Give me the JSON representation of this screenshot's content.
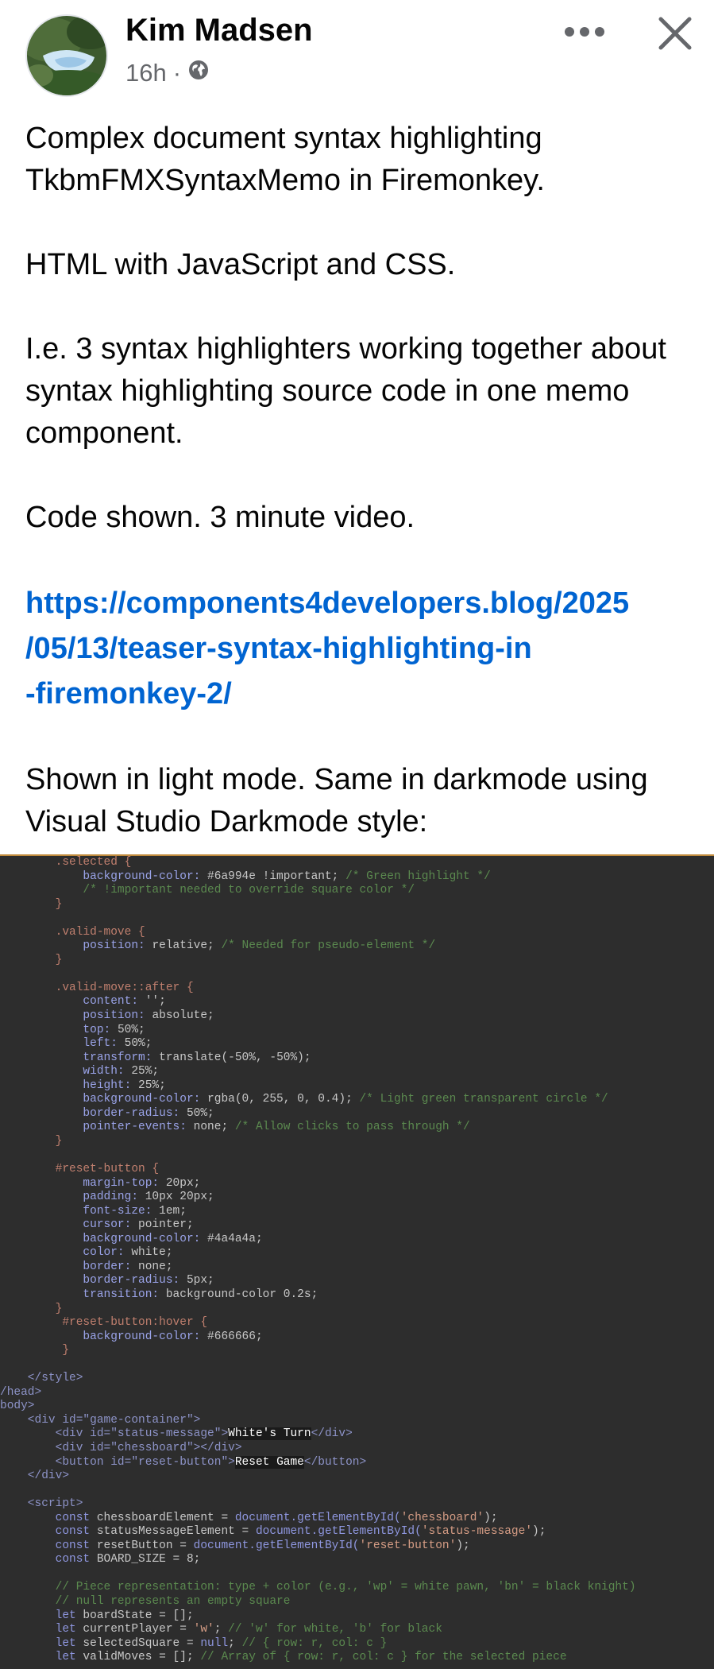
{
  "post": {
    "author": "Kim Madsen",
    "time": "16h",
    "separator": "·",
    "more_label": "•••",
    "close_label": "✕",
    "paragraphs": [
      "Complex document syntax highlighting TkbmFMXSyntaxMemo in Firemonkey.",
      "HTML with JavaScript and CSS.",
      "I.e. 3 syntax highlighters working together about syntax highlighting source code in one memo component.",
      "Code shown. 3 minute video."
    ],
    "link_lines": [
      "https://components4developers.blog/2025",
      "/05/13/teaser-syntax-highlighting-in",
      "-firemonkey-2/"
    ],
    "closing": "Shown in light mode. Same in darkmode using Visual Studio Darkmode style:"
  },
  "icons": {
    "globe": "globe-icon",
    "more": "more-icon",
    "close": "close-icon",
    "avatar": "avatar-photo"
  },
  "code_lines": [
    [
      [
        "sel",
        "        .selected {"
      ]
    ],
    [
      [
        "prop",
        "            background-color: "
      ],
      [
        "val",
        "#6a994e !important; "
      ],
      [
        "cmt",
        "/* Green highlight */"
      ]
    ],
    [
      [
        "cmt",
        "            /* !important needed to override square color */"
      ]
    ],
    [
      [
        "sel",
        "        }"
      ]
    ],
    [
      [
        "val",
        ""
      ]
    ],
    [
      [
        "sel",
        "        .valid-move {"
      ]
    ],
    [
      [
        "prop",
        "            position: "
      ],
      [
        "val",
        "relative; "
      ],
      [
        "cmt",
        "/* Needed for pseudo-element */"
      ]
    ],
    [
      [
        "sel",
        "        }"
      ]
    ],
    [
      [
        "val",
        ""
      ]
    ],
    [
      [
        "sel",
        "        .valid-move::after {"
      ]
    ],
    [
      [
        "prop",
        "            content: "
      ],
      [
        "val",
        "'';"
      ]
    ],
    [
      [
        "prop",
        "            position: "
      ],
      [
        "val",
        "absolute;"
      ]
    ],
    [
      [
        "prop",
        "            top: "
      ],
      [
        "val",
        "50%;"
      ]
    ],
    [
      [
        "prop",
        "            left: "
      ],
      [
        "val",
        "50%;"
      ]
    ],
    [
      [
        "prop",
        "            transform: "
      ],
      [
        "val",
        "translate(-50%, -50%);"
      ]
    ],
    [
      [
        "prop",
        "            width: "
      ],
      [
        "val",
        "25%;"
      ]
    ],
    [
      [
        "prop",
        "            height: "
      ],
      [
        "val",
        "25%;"
      ]
    ],
    [
      [
        "prop",
        "            background-color: "
      ],
      [
        "val",
        "rgba(0, 255, 0, 0.4); "
      ],
      [
        "cmt",
        "/* Light green transparent circle */"
      ]
    ],
    [
      [
        "prop",
        "            border-radius: "
      ],
      [
        "val",
        "50%;"
      ]
    ],
    [
      [
        "prop",
        "            pointer-events: "
      ],
      [
        "val",
        "none; "
      ],
      [
        "cmt",
        "/* Allow clicks to pass through */"
      ]
    ],
    [
      [
        "sel",
        "        }"
      ]
    ],
    [
      [
        "val",
        ""
      ]
    ],
    [
      [
        "sel",
        "        #reset-button {"
      ]
    ],
    [
      [
        "prop",
        "            margin-top: "
      ],
      [
        "val",
        "20px;"
      ]
    ],
    [
      [
        "prop",
        "            padding: "
      ],
      [
        "val",
        "10px 20px;"
      ]
    ],
    [
      [
        "prop",
        "            font-size: "
      ],
      [
        "val",
        "1em;"
      ]
    ],
    [
      [
        "prop",
        "            cursor: "
      ],
      [
        "val",
        "pointer;"
      ]
    ],
    [
      [
        "prop",
        "            background-color: "
      ],
      [
        "val",
        "#4a4a4a;"
      ]
    ],
    [
      [
        "prop",
        "            color: "
      ],
      [
        "val",
        "white;"
      ]
    ],
    [
      [
        "prop",
        "            border: "
      ],
      [
        "val",
        "none;"
      ]
    ],
    [
      [
        "prop",
        "            border-radius: "
      ],
      [
        "val",
        "5px;"
      ]
    ],
    [
      [
        "prop",
        "            transition: "
      ],
      [
        "val",
        "background-color 0.2s;"
      ]
    ],
    [
      [
        "sel",
        "        }"
      ]
    ],
    [
      [
        "sel",
        "         #reset-button:hover {"
      ]
    ],
    [
      [
        "prop",
        "            background-color: "
      ],
      [
        "val",
        "#666666;"
      ]
    ],
    [
      [
        "sel",
        "         }"
      ]
    ],
    [
      [
        "val",
        ""
      ]
    ],
    [
      [
        "tag",
        "    </style>"
      ]
    ],
    [
      [
        "tag",
        "/head>"
      ]
    ],
    [
      [
        "tag",
        "body>"
      ]
    ],
    [
      [
        "tag",
        "    <div id=\"game-container\">"
      ]
    ],
    [
      [
        "tag",
        "        <div id=\"status-message\">"
      ],
      [
        "hi",
        "White's Turn"
      ],
      [
        "tag",
        "</div>"
      ]
    ],
    [
      [
        "tag",
        "        <div id=\"chessboard\"></div>"
      ]
    ],
    [
      [
        "tag",
        "        <button id=\"reset-button\">"
      ],
      [
        "hi",
        "Reset Game"
      ],
      [
        "tag",
        "</button>"
      ]
    ],
    [
      [
        "tag",
        "    </div>"
      ]
    ],
    [
      [
        "val",
        ""
      ]
    ],
    [
      [
        "tag",
        "    <script>"
      ]
    ],
    [
      [
        "kw",
        "        const "
      ],
      [
        "val",
        "chessboardElement = "
      ],
      [
        "kw",
        "document.getElementById("
      ],
      [
        "str",
        "'chessboard'"
      ],
      [
        "val",
        ");"
      ]
    ],
    [
      [
        "kw",
        "        const "
      ],
      [
        "val",
        "statusMessageElement = "
      ],
      [
        "kw",
        "document.getElementById("
      ],
      [
        "str",
        "'status-message'"
      ],
      [
        "val",
        ");"
      ]
    ],
    [
      [
        "kw",
        "        const "
      ],
      [
        "val",
        "resetButton = "
      ],
      [
        "kw",
        "document.getElementById("
      ],
      [
        "str",
        "'reset-button'"
      ],
      [
        "val",
        ");"
      ]
    ],
    [
      [
        "kw",
        "        const "
      ],
      [
        "val",
        "BOARD_SIZE = 8;"
      ]
    ],
    [
      [
        "val",
        ""
      ]
    ],
    [
      [
        "cmt",
        "        // Piece representation: type + color (e.g., 'wp' = white pawn, 'bn' = black knight)"
      ]
    ],
    [
      [
        "cmt",
        "        // null represents an empty square"
      ]
    ],
    [
      [
        "kw",
        "        let "
      ],
      [
        "val",
        "boardState = [];"
      ]
    ],
    [
      [
        "kw",
        "        let "
      ],
      [
        "val",
        "currentPlayer = "
      ],
      [
        "str",
        "'w'"
      ],
      [
        "val",
        "; "
      ],
      [
        "cmt",
        "// 'w' for white, 'b' for black"
      ]
    ],
    [
      [
        "kw",
        "        let "
      ],
      [
        "val",
        "selectedSquare = "
      ],
      [
        "kw",
        "null"
      ],
      [
        "val",
        "; "
      ],
      [
        "cmt",
        "// { row: r, col: c }"
      ]
    ],
    [
      [
        "kw",
        "        let "
      ],
      [
        "val",
        "validMoves = []; "
      ],
      [
        "cmt",
        "// Array of { row: r, col: c } for the selected piece"
      ]
    ]
  ]
}
